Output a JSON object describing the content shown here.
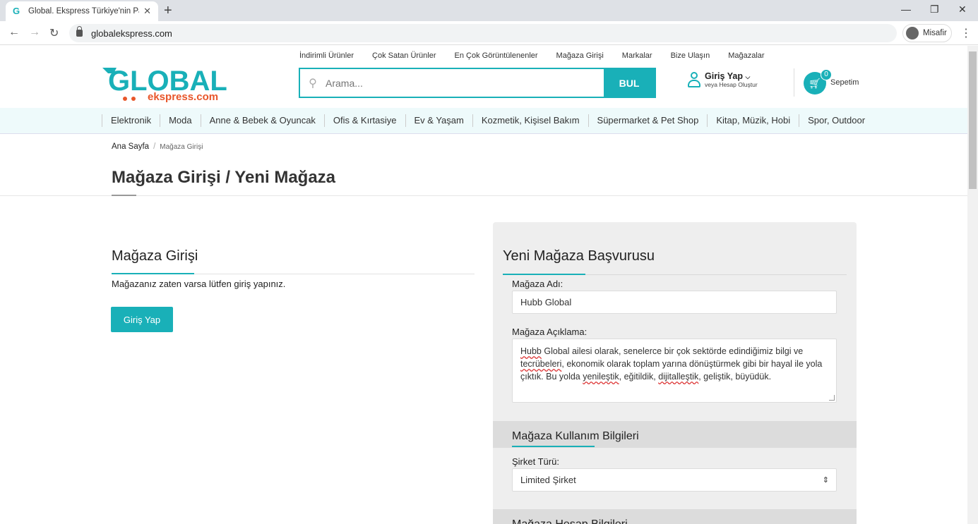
{
  "browser": {
    "tab_title": "Global. Ekspress Türkiye'nin Pazar",
    "url": "globalekspress.com",
    "profile": "Misafir"
  },
  "header": {
    "logo_top": "GLOBAL",
    "logo_bottom": "ekspress.com",
    "top_links": [
      "İndirimli Ürünler",
      "Çok Satan Ürünler",
      "En Çok Görüntülenenler",
      "Mağaza Girişi",
      "Markalar",
      "Bize Ulaşın",
      "Mağazalar"
    ],
    "search_placeholder": "Arama...",
    "search_button": "BUL",
    "login_title": "Giriş Yap",
    "login_sub": "veya Hesap Oluştur",
    "cart_count": "0",
    "cart_label": "Sepetim"
  },
  "categories": [
    "Elektronik",
    "Moda",
    "Anne & Bebek & Oyuncak",
    "Ofis & Kırtasiye",
    "Ev & Yaşam",
    "Kozmetik, Kişisel Bakım",
    "Süpermarket & Pet Shop",
    "Kitap, Müzik, Hobi",
    "Spor, Outdoor"
  ],
  "breadcrumb": {
    "home": "Ana Sayfa",
    "current": "Mağaza Girişi"
  },
  "page_title": "Mağaza Girişi / Yeni Mağaza",
  "login_section": {
    "title": "Mağaza Girişi",
    "text": "Mağazanız zaten varsa lütfen giriş yapınız.",
    "button": "Giriş Yap"
  },
  "new_store": {
    "title": "Yeni Mağaza Başvurusu",
    "name_label": "Mağaza Adı:",
    "name_value": "Hubb Global",
    "desc_label": "Mağaza Açıklama:",
    "desc_parts": [
      "Hubb",
      " Global ailesi olarak, senelerce bir çok sektörde edindiğimiz bilgi ve ",
      "tecrübeleri",
      ", ekonomik olarak toplam yarına dönüştürmek gibi bir hayal ile yola çıktık. Bu yolda ",
      "yenileştik",
      ", eğitildik, ",
      "dijitalleştik",
      ", geliştik, büyüdük."
    ],
    "usage_section": "Mağaza Kullanım Bilgileri",
    "company_type_label": "Şirket Türü:",
    "company_type_value": "Limited Şirket",
    "account_section": "Mağaza Hesap Bilgileri"
  },
  "colors": {
    "accent": "#19b0b8",
    "logo_orange": "#e8562a"
  }
}
